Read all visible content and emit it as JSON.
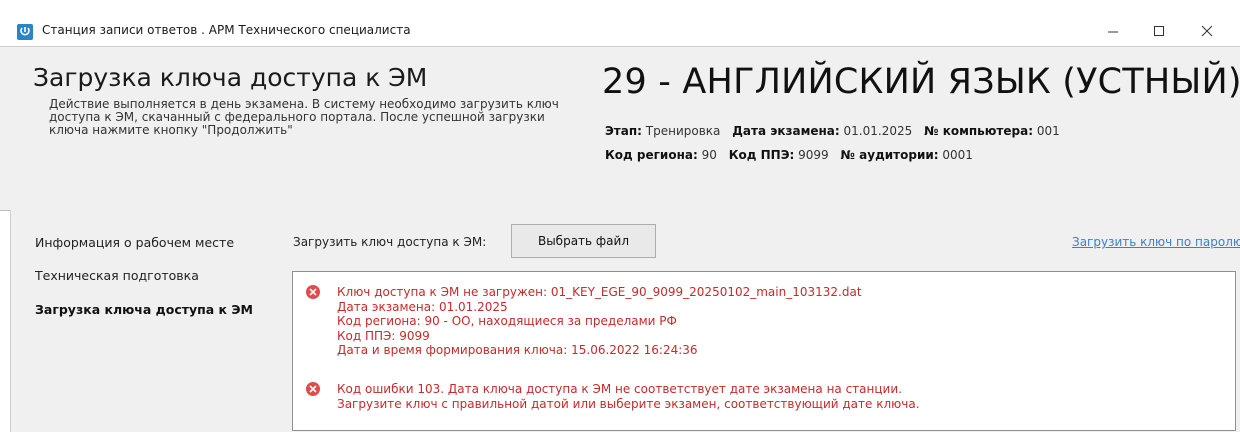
{
  "window": {
    "title": "Станция записи ответов . АРМ Технического специалиста"
  },
  "header": {
    "title": "Загрузка ключа доступа к ЭМ",
    "description": "Действие выполняется в день экзамена. В систему необходимо загрузить ключ доступа к ЭМ, скачанный с федерального портала. После успешной загрузки ключа нажмите кнопку \"Продолжить\"",
    "subject": "29 - АНГЛИЙСКИЙ ЯЗЫК (УСТНЫЙ)",
    "meta_row1": [
      {
        "label": "Этап:",
        "value": "Тренировка"
      },
      {
        "label": "Дата экзамена:",
        "value": "01.01.2025"
      },
      {
        "label": "№ компьютера:",
        "value": "001"
      }
    ],
    "meta_row2": [
      {
        "label": "Код региона:",
        "value": "90"
      },
      {
        "label": "Код ППЭ:",
        "value": "9099"
      },
      {
        "label": "№ аудитории:",
        "value": "0001"
      }
    ]
  },
  "sidebar": {
    "items": [
      {
        "label": "Информация о рабочем месте",
        "active": false
      },
      {
        "label": "Техническая подготовка",
        "active": false
      },
      {
        "label": "Загрузка ключа доступа к ЭМ",
        "active": true
      }
    ]
  },
  "main": {
    "load_label": "Загрузить ключ доступа к ЭМ:",
    "choose_file_button": "Выбрать файл",
    "password_link": "Загрузить ключ по паролю",
    "errors": [
      {
        "icon": "error-icon",
        "lines": [
          "Ключ доступа к ЭМ не загружен: 01_KEY_EGE_90_9099_20250102_main_103132.dat",
          "Дата экзамена: 01.01.2025",
          "Код региона: 90 - ОО, находящиеся за пределами РФ",
          "Код ППЭ: 9099",
          "Дата и время формирования ключа: 15.06.2022 16:24:36"
        ]
      },
      {
        "icon": "error-icon",
        "lines": [
          "Код ошибки 103. Дата ключа доступа к ЭМ не соответствует дате экзамена на станции.",
          "Загрузите ключ с правильной датой или выберите экзамен, соответствующий дате ключа."
        ]
      }
    ]
  },
  "colors": {
    "panel_bg": "#f0f0f0",
    "error_text": "#c42b2b",
    "error_icon": "#e04b4b",
    "link": "#3b7fd0",
    "app_icon": "#2a84c6"
  }
}
